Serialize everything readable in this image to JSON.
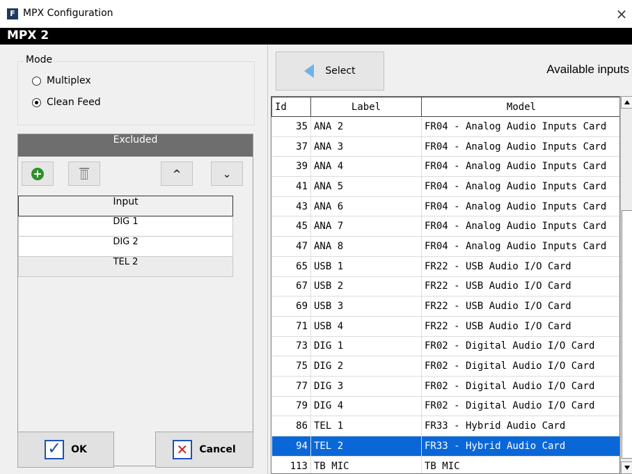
{
  "window": {
    "app_icon": "F",
    "title": "MPX Configuration",
    "close_glyph": "×"
  },
  "header": {
    "title": "MPX 2"
  },
  "mode": {
    "legend": "Mode",
    "options": [
      {
        "label": "Multiplex",
        "checked": false
      },
      {
        "label": "Clean Feed",
        "checked": true
      }
    ]
  },
  "excluded": {
    "title": "Excluded",
    "toolbar": {
      "add_icon": "plus-circle-icon",
      "delete_icon": "trash-icon",
      "up_glyph": "^",
      "down_glyph": "⌄"
    },
    "column_header": "Input",
    "rows": [
      "DIG 1",
      "DIG 2",
      "TEL 2"
    ]
  },
  "buttons": {
    "ok": "OK",
    "cancel": "Cancel"
  },
  "available": {
    "select_label": "Select",
    "title": "Available inputs",
    "columns": [
      "Id",
      "Label",
      "Model"
    ],
    "rows": [
      {
        "id": "35",
        "label": "ANA 2",
        "model": "FR04 - Analog Audio Inputs Card"
      },
      {
        "id": "37",
        "label": "ANA 3",
        "model": "FR04 - Analog Audio Inputs Card"
      },
      {
        "id": "39",
        "label": "ANA 4",
        "model": "FR04 - Analog Audio Inputs Card"
      },
      {
        "id": "41",
        "label": "ANA 5",
        "model": "FR04 - Analog Audio Inputs Card"
      },
      {
        "id": "43",
        "label": "ANA 6",
        "model": "FR04 - Analog Audio Inputs Card"
      },
      {
        "id": "45",
        "label": "ANA 7",
        "model": "FR04 - Analog Audio Inputs Card"
      },
      {
        "id": "47",
        "label": "ANA 8",
        "model": "FR04 - Analog Audio Inputs Card"
      },
      {
        "id": "65",
        "label": "USB 1",
        "model": "FR22 - USB Audio I/O Card"
      },
      {
        "id": "67",
        "label": "USB 2",
        "model": "FR22 - USB Audio I/O Card"
      },
      {
        "id": "69",
        "label": "USB 3",
        "model": "FR22 - USB Audio I/O Card"
      },
      {
        "id": "71",
        "label": "USB 4",
        "model": "FR22 - USB Audio I/O Card"
      },
      {
        "id": "73",
        "label": "DIG 1",
        "model": "FR02 - Digital Audio I/O Card"
      },
      {
        "id": "75",
        "label": "DIG 2",
        "model": "FR02 - Digital Audio I/O Card"
      },
      {
        "id": "77",
        "label": "DIG 3",
        "model": "FR02 - Digital Audio I/O Card"
      },
      {
        "id": "79",
        "label": "DIG 4",
        "model": "FR02 - Digital Audio I/O Card"
      },
      {
        "id": "86",
        "label": "TEL 1",
        "model": "FR33 - Hybrid Audio Card"
      },
      {
        "id": "94",
        "label": "TEL 2",
        "model": "FR33 - Hybrid Audio Card",
        "selected": true
      },
      {
        "id": "113",
        "label": "TB MIC",
        "model": "TB MIC"
      }
    ]
  },
  "colors": {
    "selection": "#0a67d8",
    "header_bar": "#000000",
    "excluded_header": "#6e6e6e"
  }
}
